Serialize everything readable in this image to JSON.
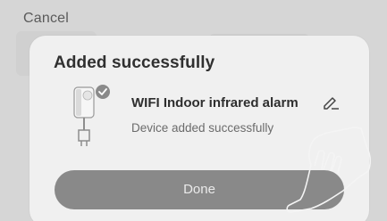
{
  "background": {
    "cancel_label": "Cancel"
  },
  "dialog": {
    "title": "Added successfully",
    "device": {
      "name": "WIFI Indoor infrared alarm",
      "status": "Device added successfully",
      "icon": "motion-sensor-icon",
      "badge_icon": "checkmark-badge-icon",
      "edit_icon": "pencil-icon"
    },
    "done_label": "Done"
  },
  "colors": {
    "sheet": "#f0f0f0",
    "button": "#898989",
    "badge": "#8a8a8a"
  }
}
